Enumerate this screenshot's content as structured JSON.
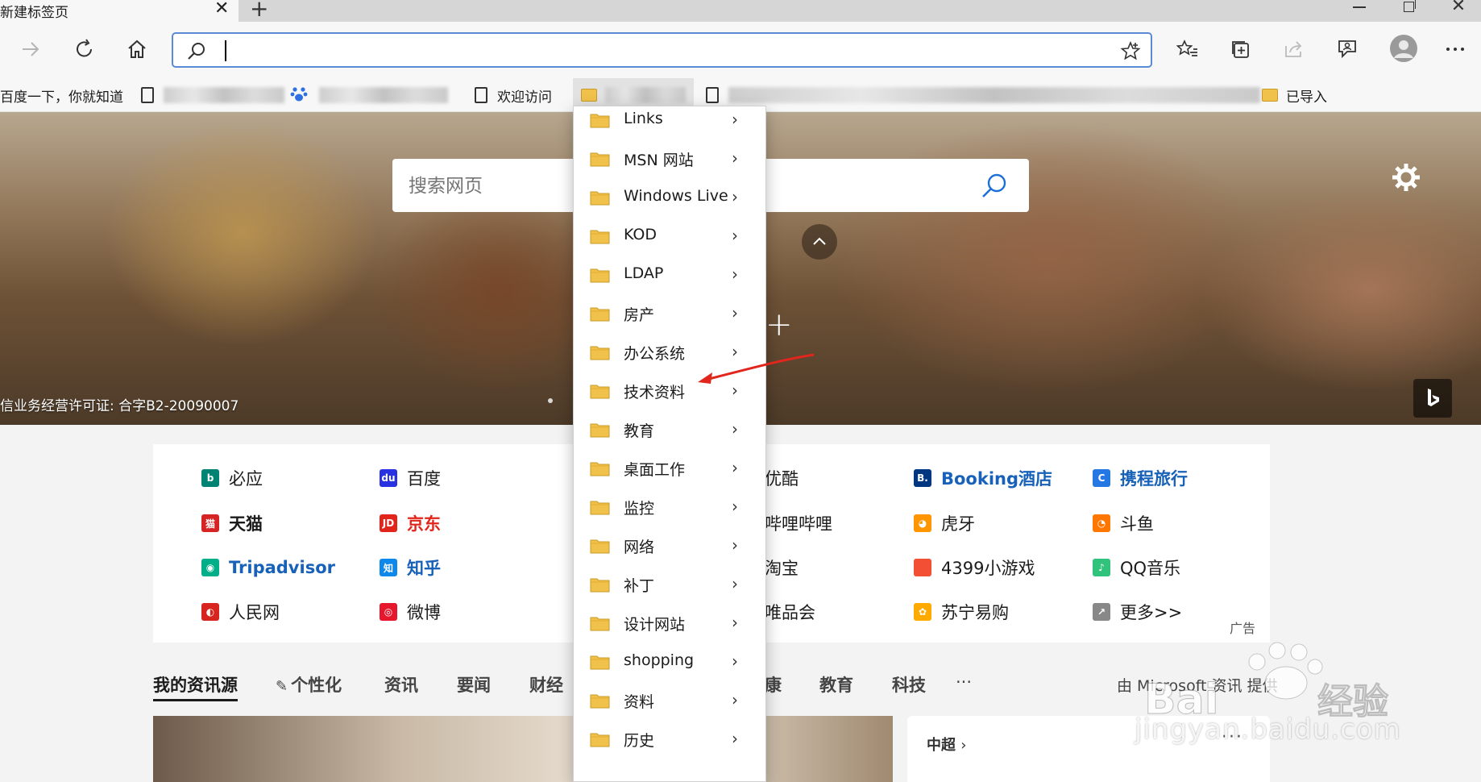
{
  "browser": {
    "tab_title": "新建标签页",
    "tab_close": "✕",
    "new_tab": "+",
    "window_close": "✕"
  },
  "favorites_bar": {
    "items": [
      {
        "label": "百度一下，你就知道",
        "icon": "baidu-text"
      },
      {
        "label": "",
        "icon": "page-icon",
        "blurred": true
      },
      {
        "label": "",
        "icon": "baidu-paw-icon",
        "blurred": true
      },
      {
        "label": "欢迎访问",
        "icon": "page-icon"
      },
      {
        "label": "",
        "icon": "folder-icon",
        "blurred": true,
        "active": true
      },
      {
        "label": "",
        "icon": "page-icon",
        "blurred": true
      },
      {
        "label": "已导入",
        "icon": "folder-icon"
      }
    ]
  },
  "hero": {
    "search_placeholder": "搜索网页",
    "license_text": "信业务经营许可证: 合字B2-20090007"
  },
  "quick_links": [
    {
      "label": "必应",
      "color": "#008373",
      "glyph": "b",
      "bold": false
    },
    {
      "label": "天猫",
      "color": "#d62323",
      "glyph": "猫",
      "bold": true
    },
    {
      "label": "Tripadvisor",
      "color": "#00af87",
      "glyph": "◉",
      "bold": true,
      "text_color": "#1761b8"
    },
    {
      "label": "人民网",
      "color": "#d8241e",
      "glyph": "◐",
      "bold": false
    },
    {
      "label": "百度",
      "color": "#2932e1",
      "glyph": "du",
      "bold": false
    },
    {
      "label": "京东",
      "color": "#e1251b",
      "glyph": "JD",
      "bold": true,
      "text_color": "#e1251b"
    },
    {
      "label": "知乎",
      "color": "#0f88eb",
      "glyph": "知",
      "bold": true,
      "text_color": "#1761b8"
    },
    {
      "label": "微博",
      "color": "#e6162d",
      "glyph": "◎",
      "bold": false
    },
    {
      "label": "优酷",
      "color": "#1ebde3",
      "glyph": "▶",
      "bold": false
    },
    {
      "label": "哔哩哔哩",
      "color": "#00a1d6",
      "glyph": "▭",
      "bold": false
    },
    {
      "label": "淘宝",
      "color": "#ff5000",
      "glyph": "淘",
      "bold": false
    },
    {
      "label": "唯品会",
      "color": "#f10180",
      "glyph": "V",
      "bold": false
    },
    {
      "label": "Booking酒店",
      "color": "#003580",
      "glyph": "B.",
      "bold": true,
      "text_color": "#1761b8"
    },
    {
      "label": "虎牙",
      "color": "#ff9600",
      "glyph": "◕",
      "bold": false
    },
    {
      "label": "4399小游戏",
      "color": "#f24f35",
      "glyph": "4399",
      "bold": false
    },
    {
      "label": "苏宁易购",
      "color": "#ffaa00",
      "glyph": "✿",
      "bold": false
    },
    {
      "label": "携程旅行",
      "color": "#2577e3",
      "glyph": "C",
      "bold": true,
      "text_color": "#1761b8"
    },
    {
      "label": "斗鱼",
      "color": "#ff7700",
      "glyph": "◔",
      "bold": false
    },
    {
      "label": "QQ音乐",
      "color": "#31c27c",
      "glyph": "♪",
      "bold": false
    },
    {
      "label": "更多>>",
      "color": "#888888",
      "glyph": "↗",
      "bold": false
    }
  ],
  "ad_label": "广告",
  "news_nav": {
    "tabs": [
      "我的资讯源",
      "个性化",
      "资讯",
      "要闻",
      "财经",
      "康",
      "教育",
      "科技",
      "···"
    ],
    "powered_by": "由 Microsoft 资讯 提供"
  },
  "news_card": {
    "title": "中超",
    "more": "···"
  },
  "dropdown": {
    "items": [
      "Links",
      "MSN 网站",
      "Windows Live",
      "KOD",
      "LDAP",
      "房产",
      "办公系统",
      "技术资料",
      "教育",
      "桌面工作",
      "监控",
      "网络",
      "补丁",
      "设计网站",
      "shopping",
      "资料",
      "历史"
    ]
  },
  "watermark": {
    "text": "jingyan.baidu.com"
  },
  "colors": {
    "accent": "#5a8ad6",
    "folder": "#f0c24b",
    "annotation": "#e0261d"
  }
}
